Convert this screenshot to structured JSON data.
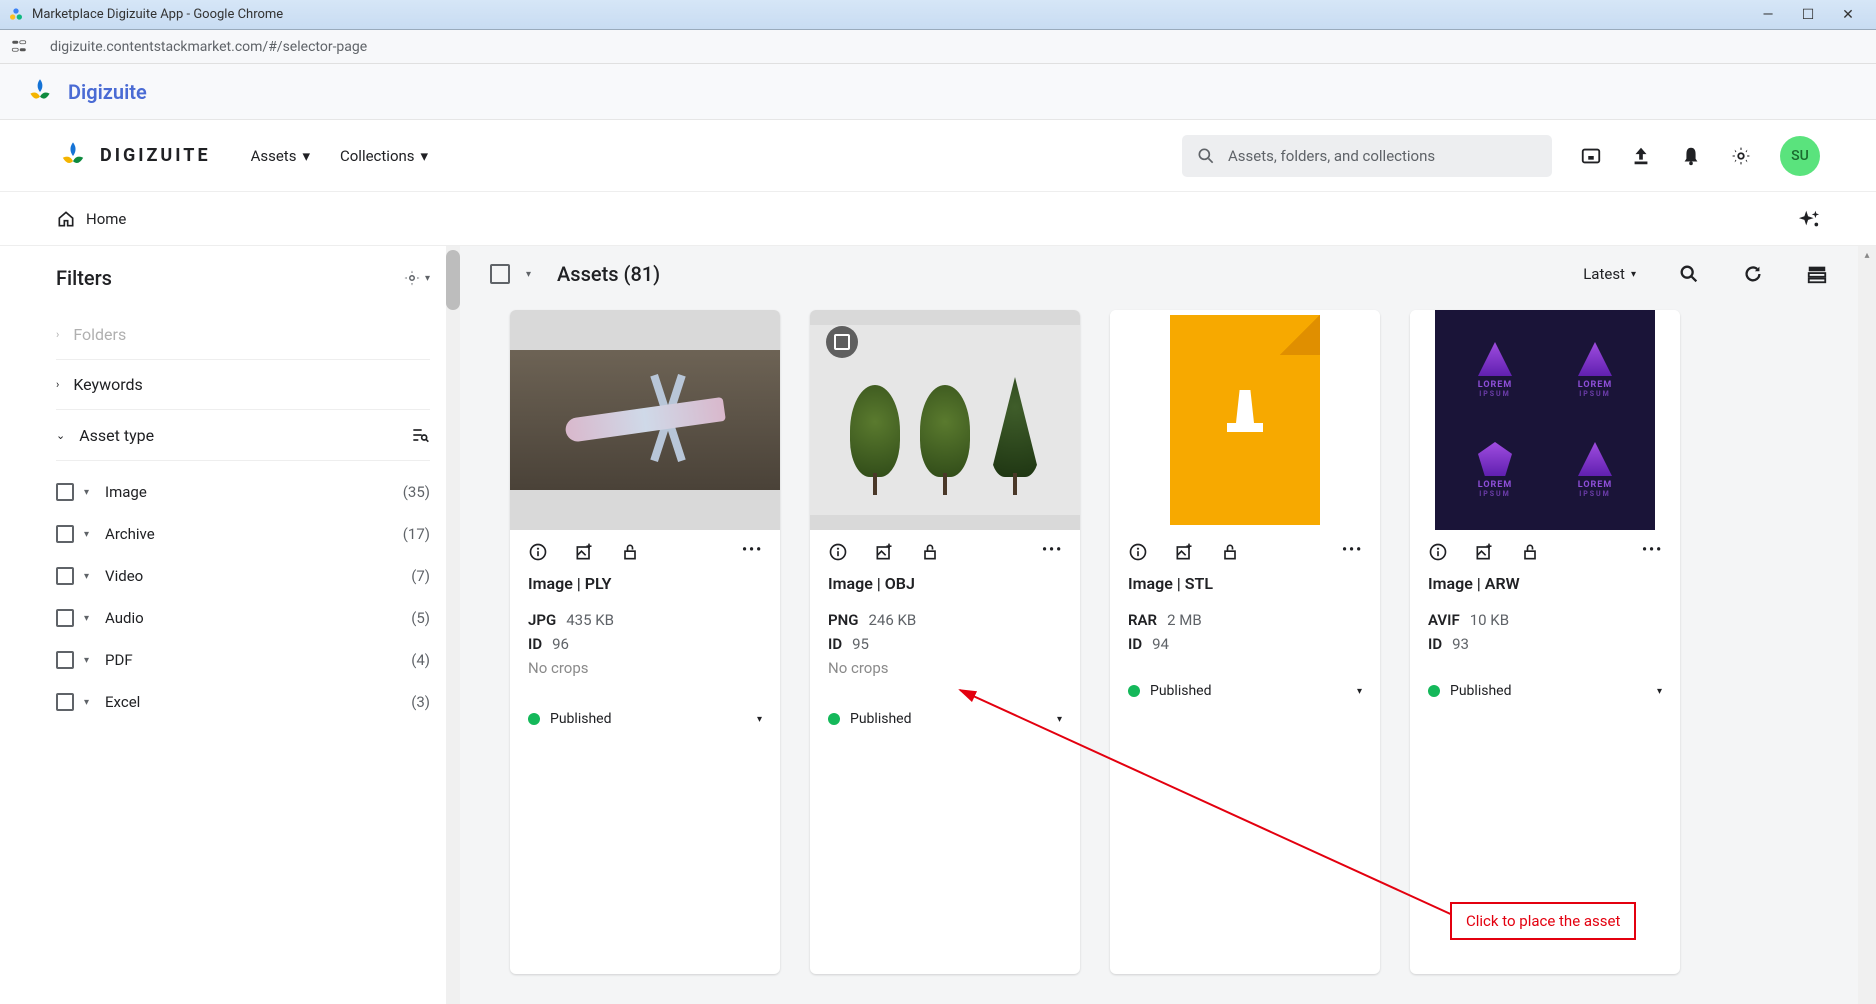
{
  "window": {
    "title": "Marketplace Digizuite App - Google Chrome"
  },
  "url": "digizuite.contentstackmarket.com/#/selector-page",
  "app_strip": {
    "brand": "Digizuite"
  },
  "header": {
    "brand": "DIGIZUITE",
    "nav": [
      {
        "label": "Assets"
      },
      {
        "label": "Collections"
      }
    ],
    "search_placeholder": "Assets, folders, and collections",
    "avatar": "SU"
  },
  "breadcrumb": {
    "home": "Home"
  },
  "filters": {
    "title": "Filters",
    "sections": {
      "folders": "Folders",
      "keywords": "Keywords",
      "asset_type": "Asset type"
    },
    "asset_types": [
      {
        "label": "Image",
        "count": "(35)"
      },
      {
        "label": "Archive",
        "count": "(17)"
      },
      {
        "label": "Video",
        "count": "(7)"
      },
      {
        "label": "Audio",
        "count": "(5)"
      },
      {
        "label": "PDF",
        "count": "(4)"
      },
      {
        "label": "Excel",
        "count": "(3)"
      }
    ]
  },
  "assets": {
    "heading": "Assets (81)",
    "sort": "Latest",
    "cards": [
      {
        "title": "Image | PLY",
        "fmt": "JPG",
        "size": "435 KB",
        "id_label": "ID",
        "id": "96",
        "crops": "No crops",
        "status": "Published"
      },
      {
        "title": "Image | OBJ",
        "fmt": "PNG",
        "size": "246 KB",
        "id_label": "ID",
        "id": "95",
        "crops": "No crops",
        "status": "Published"
      },
      {
        "title": "Image | STL",
        "fmt": "RAR",
        "size": "2 MB",
        "id_label": "ID",
        "id": "94",
        "status": "Published"
      },
      {
        "title": "Image | ARW",
        "fmt": "AVIF",
        "size": "10 KB",
        "id_label": "ID",
        "id": "93",
        "status": "Published"
      }
    ]
  },
  "annotation": {
    "text": "Click to place the asset"
  },
  "logo_text": {
    "l1": "LOREM",
    "l2": "IPSUM"
  }
}
